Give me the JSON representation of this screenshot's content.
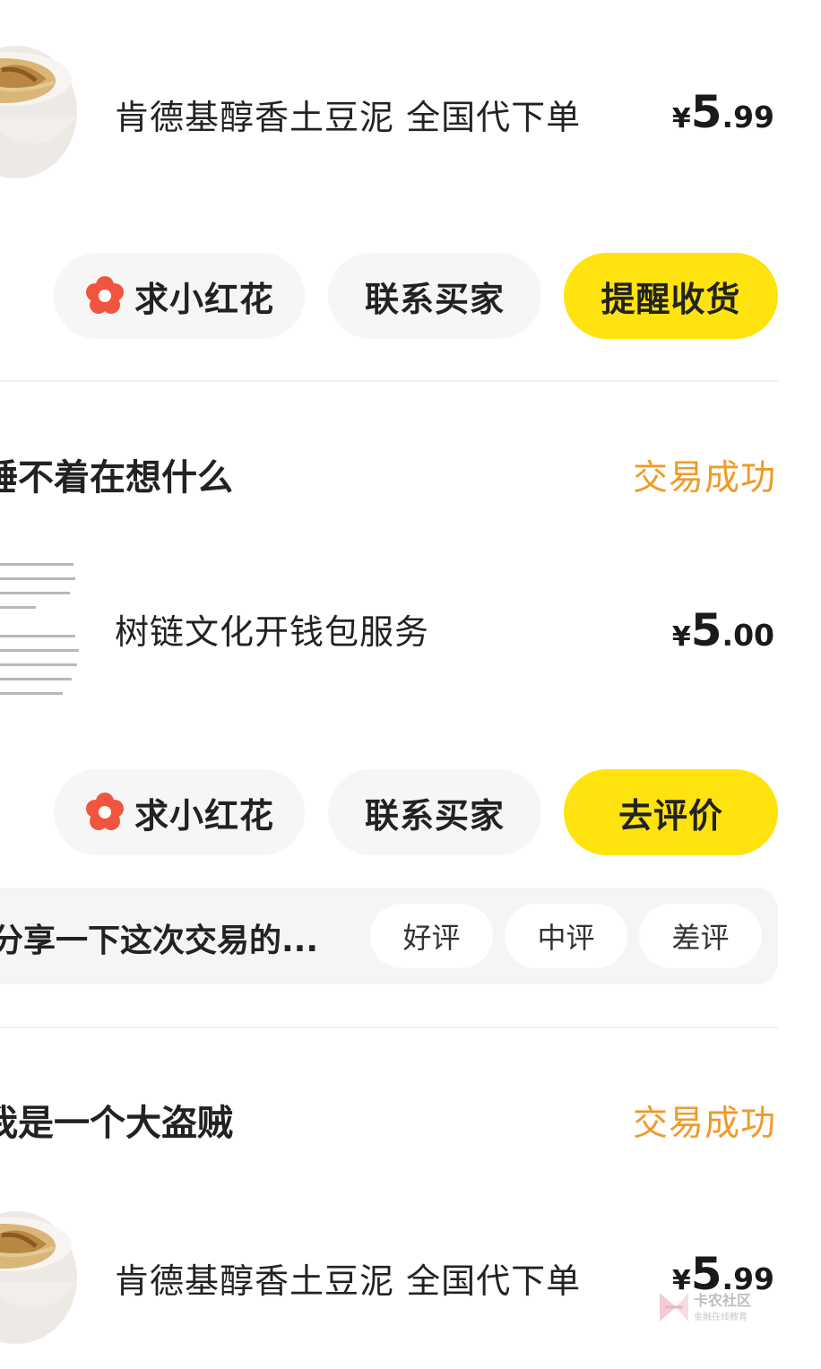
{
  "orders": [
    {
      "product_title": "肯德基醇香土豆泥 全国代下单",
      "price": {
        "currency": "¥",
        "integer": "5",
        "decimal": ".99"
      },
      "buttons": {
        "flower": "求小红花",
        "contact": "联系买家",
        "primary": "提醒收货"
      }
    },
    {
      "shop_name": "睡不着在想什么",
      "status": "交易成功",
      "product_title": "树链文化开钱包服务",
      "price": {
        "currency": "¥",
        "integer": "5",
        "decimal": ".00"
      },
      "buttons": {
        "flower": "求小红花",
        "contact": "联系买家",
        "primary": "去评价"
      },
      "review": {
        "prompt": "分享一下这次交易的...",
        "options": [
          "好评",
          "中评",
          "差评"
        ]
      }
    },
    {
      "shop_name": "我是一个大盗贼",
      "status": "交易成功",
      "product_title": "肯德基醇香土豆泥 全国代下单",
      "price": {
        "currency": "¥",
        "integer": "5",
        "decimal": ".99"
      }
    }
  ],
  "colors": {
    "primary_button": "#ffe30f",
    "status_text": "#f09a27",
    "flower_icon": "#f2553f",
    "secondary_button": "#f6f6f6",
    "review_bar": "#f5f5f5"
  },
  "icons": [
    "flower-icon",
    "potato-bowl-thumbnail",
    "document-thumbnail",
    "watermark-logo"
  ]
}
